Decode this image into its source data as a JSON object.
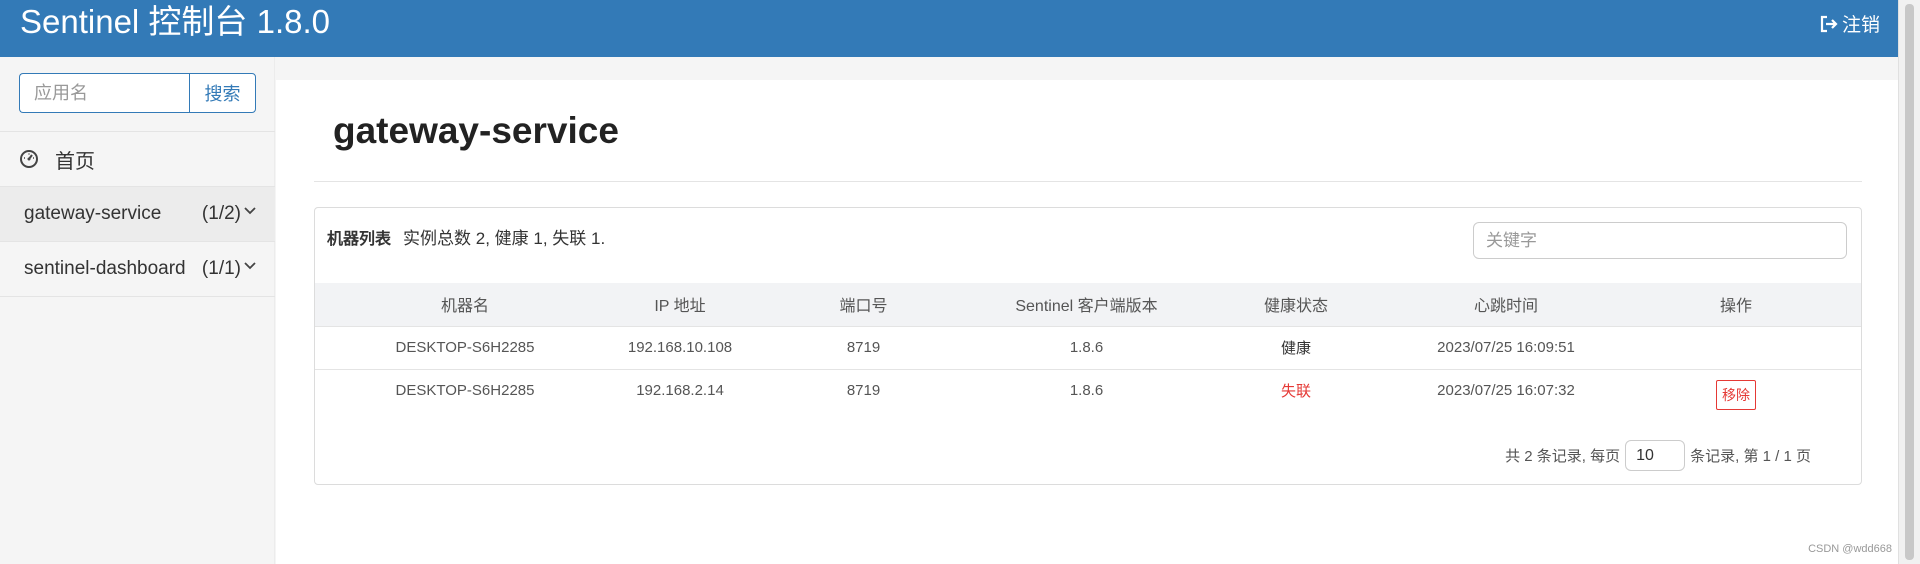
{
  "header": {
    "title": "Sentinel 控制台 1.8.0",
    "logout_label": "注销"
  },
  "sidebar": {
    "search_placeholder": "应用名",
    "search_button": "搜索",
    "home_label": "首页",
    "apps": [
      {
        "name": "gateway-service",
        "count": "(1/2)"
      },
      {
        "name": "sentinel-dashboard",
        "count": "(1/1)"
      }
    ]
  },
  "main": {
    "page_title": "gateway-service",
    "panel_title": "机器列表",
    "summary": "实例总数 2, 健康 1, 失联 1.",
    "keyword_placeholder": "关键字",
    "columns": [
      "机器名",
      "IP 地址",
      "端口号",
      "Sentinel 客户端版本",
      "健康状态",
      "心跳时间",
      "操作"
    ],
    "rows": [
      {
        "host": "DESKTOP-S6H2285",
        "ip": "192.168.10.108",
        "port": "8719",
        "version": "1.8.6",
        "status": "健康",
        "heartbeat": "2023/07/25 16:09:51",
        "action": ""
      },
      {
        "host": "DESKTOP-S6H2285",
        "ip": "192.168.2.14",
        "port": "8719",
        "version": "1.8.6",
        "status": "失联",
        "heartbeat": "2023/07/25 16:07:32",
        "action": "移除"
      }
    ],
    "pager": {
      "prefix": "共 2 条记录, 每页",
      "page_size": "10",
      "suffix": "条记录, 第 1 / 1 页"
    }
  },
  "watermark": "CSDN @wdd668",
  "colors": {
    "header": "#337ab7",
    "danger": "#e53935"
  }
}
